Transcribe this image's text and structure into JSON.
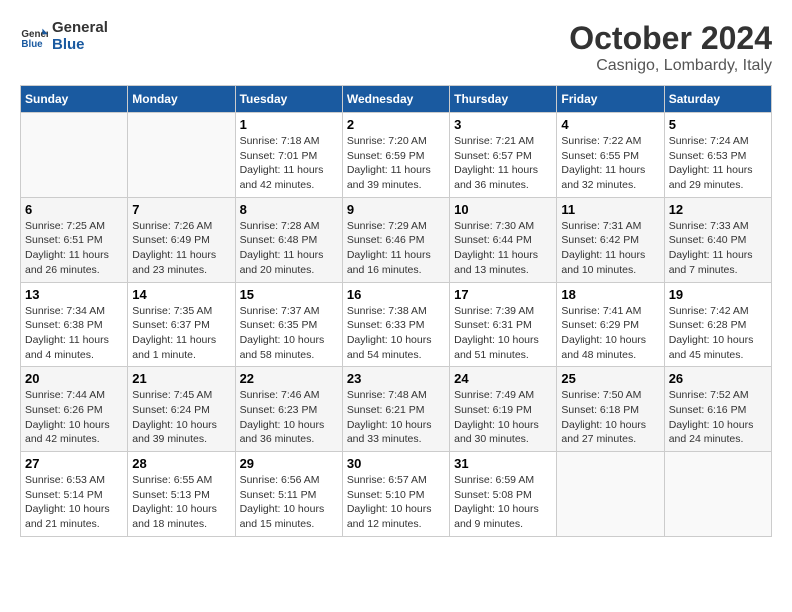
{
  "header": {
    "logo_line1": "General",
    "logo_line2": "Blue",
    "month_title": "October 2024",
    "location": "Casnigo, Lombardy, Italy"
  },
  "days_of_week": [
    "Sunday",
    "Monday",
    "Tuesday",
    "Wednesday",
    "Thursday",
    "Friday",
    "Saturday"
  ],
  "weeks": [
    [
      {
        "day": "",
        "info": ""
      },
      {
        "day": "",
        "info": ""
      },
      {
        "day": "1",
        "info": "Sunrise: 7:18 AM\nSunset: 7:01 PM\nDaylight: 11 hours and 42 minutes."
      },
      {
        "day": "2",
        "info": "Sunrise: 7:20 AM\nSunset: 6:59 PM\nDaylight: 11 hours and 39 minutes."
      },
      {
        "day": "3",
        "info": "Sunrise: 7:21 AM\nSunset: 6:57 PM\nDaylight: 11 hours and 36 minutes."
      },
      {
        "day": "4",
        "info": "Sunrise: 7:22 AM\nSunset: 6:55 PM\nDaylight: 11 hours and 32 minutes."
      },
      {
        "day": "5",
        "info": "Sunrise: 7:24 AM\nSunset: 6:53 PM\nDaylight: 11 hours and 29 minutes."
      }
    ],
    [
      {
        "day": "6",
        "info": "Sunrise: 7:25 AM\nSunset: 6:51 PM\nDaylight: 11 hours and 26 minutes."
      },
      {
        "day": "7",
        "info": "Sunrise: 7:26 AM\nSunset: 6:49 PM\nDaylight: 11 hours and 23 minutes."
      },
      {
        "day": "8",
        "info": "Sunrise: 7:28 AM\nSunset: 6:48 PM\nDaylight: 11 hours and 20 minutes."
      },
      {
        "day": "9",
        "info": "Sunrise: 7:29 AM\nSunset: 6:46 PM\nDaylight: 11 hours and 16 minutes."
      },
      {
        "day": "10",
        "info": "Sunrise: 7:30 AM\nSunset: 6:44 PM\nDaylight: 11 hours and 13 minutes."
      },
      {
        "day": "11",
        "info": "Sunrise: 7:31 AM\nSunset: 6:42 PM\nDaylight: 11 hours and 10 minutes."
      },
      {
        "day": "12",
        "info": "Sunrise: 7:33 AM\nSunset: 6:40 PM\nDaylight: 11 hours and 7 minutes."
      }
    ],
    [
      {
        "day": "13",
        "info": "Sunrise: 7:34 AM\nSunset: 6:38 PM\nDaylight: 11 hours and 4 minutes."
      },
      {
        "day": "14",
        "info": "Sunrise: 7:35 AM\nSunset: 6:37 PM\nDaylight: 11 hours and 1 minute."
      },
      {
        "day": "15",
        "info": "Sunrise: 7:37 AM\nSunset: 6:35 PM\nDaylight: 10 hours and 58 minutes."
      },
      {
        "day": "16",
        "info": "Sunrise: 7:38 AM\nSunset: 6:33 PM\nDaylight: 10 hours and 54 minutes."
      },
      {
        "day": "17",
        "info": "Sunrise: 7:39 AM\nSunset: 6:31 PM\nDaylight: 10 hours and 51 minutes."
      },
      {
        "day": "18",
        "info": "Sunrise: 7:41 AM\nSunset: 6:29 PM\nDaylight: 10 hours and 48 minutes."
      },
      {
        "day": "19",
        "info": "Sunrise: 7:42 AM\nSunset: 6:28 PM\nDaylight: 10 hours and 45 minutes."
      }
    ],
    [
      {
        "day": "20",
        "info": "Sunrise: 7:44 AM\nSunset: 6:26 PM\nDaylight: 10 hours and 42 minutes."
      },
      {
        "day": "21",
        "info": "Sunrise: 7:45 AM\nSunset: 6:24 PM\nDaylight: 10 hours and 39 minutes."
      },
      {
        "day": "22",
        "info": "Sunrise: 7:46 AM\nSunset: 6:23 PM\nDaylight: 10 hours and 36 minutes."
      },
      {
        "day": "23",
        "info": "Sunrise: 7:48 AM\nSunset: 6:21 PM\nDaylight: 10 hours and 33 minutes."
      },
      {
        "day": "24",
        "info": "Sunrise: 7:49 AM\nSunset: 6:19 PM\nDaylight: 10 hours and 30 minutes."
      },
      {
        "day": "25",
        "info": "Sunrise: 7:50 AM\nSunset: 6:18 PM\nDaylight: 10 hours and 27 minutes."
      },
      {
        "day": "26",
        "info": "Sunrise: 7:52 AM\nSunset: 6:16 PM\nDaylight: 10 hours and 24 minutes."
      }
    ],
    [
      {
        "day": "27",
        "info": "Sunrise: 6:53 AM\nSunset: 5:14 PM\nDaylight: 10 hours and 21 minutes."
      },
      {
        "day": "28",
        "info": "Sunrise: 6:55 AM\nSunset: 5:13 PM\nDaylight: 10 hours and 18 minutes."
      },
      {
        "day": "29",
        "info": "Sunrise: 6:56 AM\nSunset: 5:11 PM\nDaylight: 10 hours and 15 minutes."
      },
      {
        "day": "30",
        "info": "Sunrise: 6:57 AM\nSunset: 5:10 PM\nDaylight: 10 hours and 12 minutes."
      },
      {
        "day": "31",
        "info": "Sunrise: 6:59 AM\nSunset: 5:08 PM\nDaylight: 10 hours and 9 minutes."
      },
      {
        "day": "",
        "info": ""
      },
      {
        "day": "",
        "info": ""
      }
    ]
  ]
}
